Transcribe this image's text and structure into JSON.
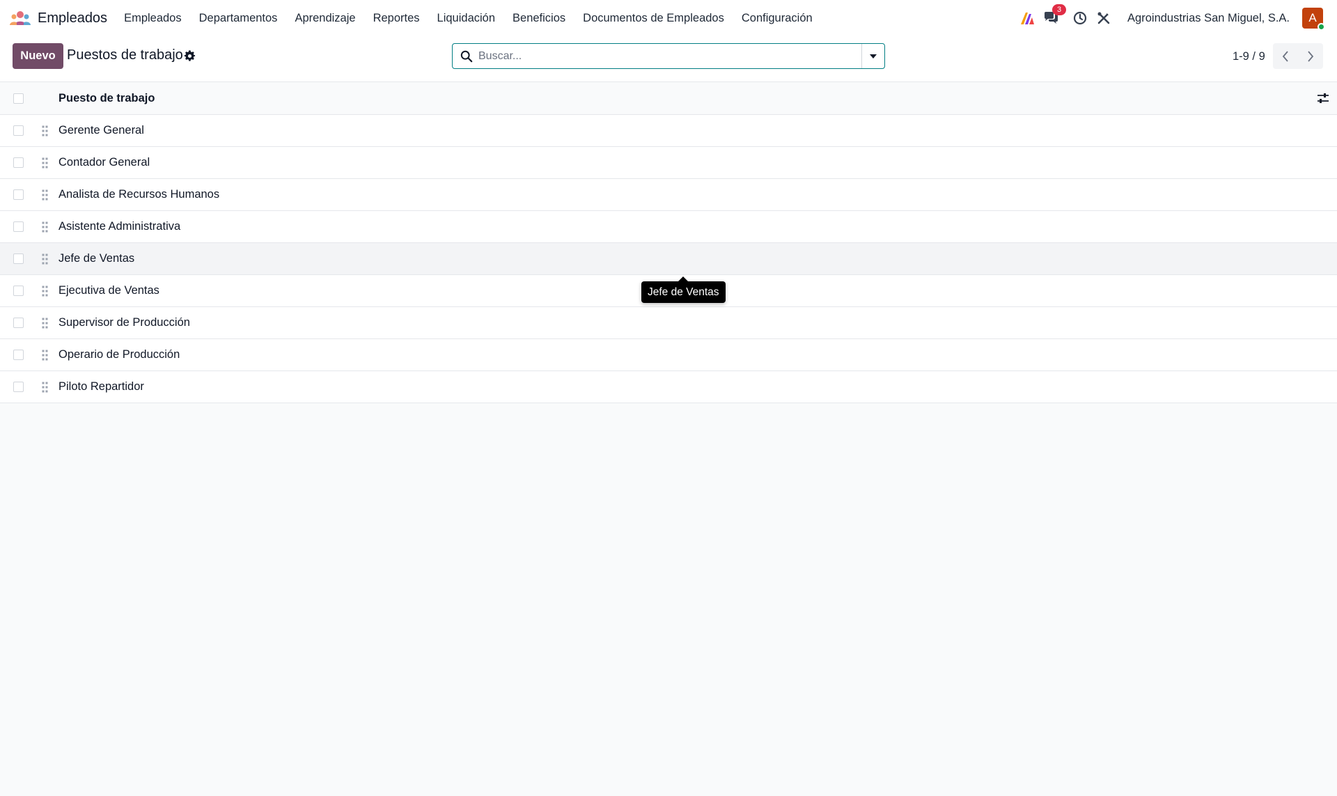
{
  "navbar": {
    "app_name": "Empleados",
    "menu": [
      "Empleados",
      "Departamentos",
      "Aprendizaje",
      "Reportes",
      "Liquidación",
      "Beneficios",
      "Documentos de Empleados",
      "Configuración"
    ],
    "messages_badge": "3",
    "company": "Agroindustrias San Miguel, S.A.",
    "avatar_letter": "A"
  },
  "control_panel": {
    "new_button": "Nuevo",
    "title": "Puestos de trabajo",
    "search_placeholder": "Buscar...",
    "pager": "1-9 / 9"
  },
  "list": {
    "column_header": "Puesto de trabajo",
    "rows": [
      "Gerente General",
      "Contador General",
      "Analista de Recursos Humanos",
      "Asistente Administrativa",
      "Jefe de Ventas",
      "Ejecutiva de Ventas",
      "Supervisor de Producción",
      "Operario de Producción",
      "Piloto Repartidor"
    ],
    "hovered_row_index": 4
  },
  "tooltip": {
    "text": "Jefe de Ventas"
  },
  "colors": {
    "brand": "#714b67",
    "accent": "#017e84",
    "badge": "#e02d45",
    "avatar": "#c2410c"
  },
  "icons": [
    "app-logo",
    "ai-icon",
    "chat-icon",
    "clock-icon",
    "tools-icon",
    "gear-icon",
    "search-icon",
    "caret-down-icon",
    "chevron-left-icon",
    "chevron-right-icon",
    "sliders-icon",
    "drag-handle-icon"
  ]
}
